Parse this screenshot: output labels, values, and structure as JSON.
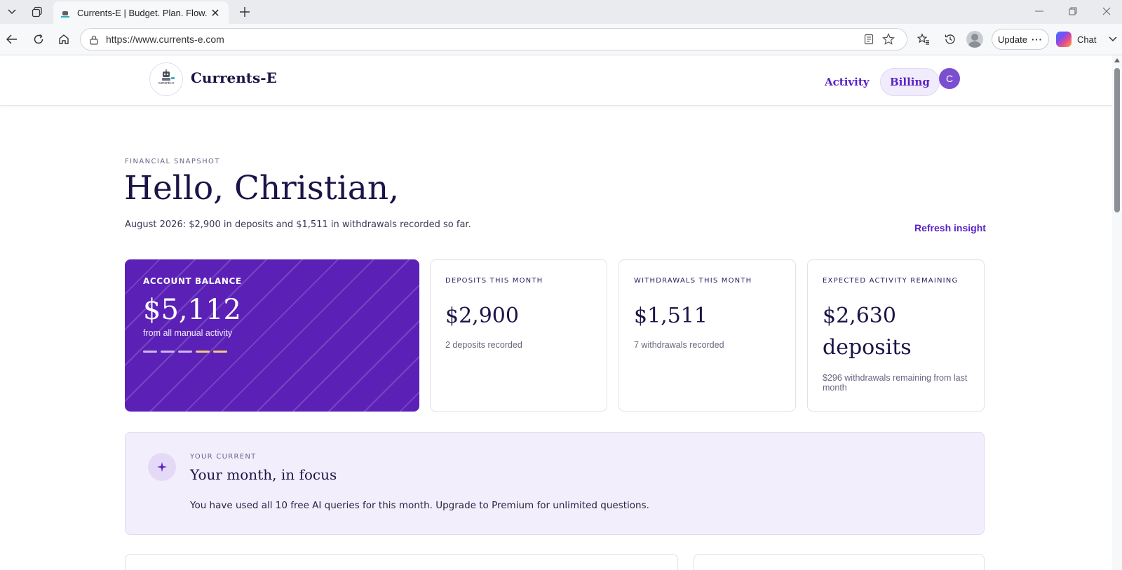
{
  "browser": {
    "tab_title": "Currents-E | Budget. Plan. Flow.",
    "url": "https://www.currents-e.com",
    "update_label": "Update",
    "chat_label": "Chat"
  },
  "site": {
    "brand": "Currents-E",
    "logo_text": "currents-e",
    "nav": {
      "activity": "Activity",
      "billing": "Billing"
    },
    "avatar_initial": "C"
  },
  "hero": {
    "eyebrow": "FINANCIAL SNAPSHOT",
    "greeting": "Hello, Christian,",
    "summary": "August 2026: $2,900 in deposits and $1,511 in withdrawals recorded so far.",
    "refresh_label": "Refresh insight"
  },
  "cards": {
    "balance": {
      "label": "ACCOUNT BALANCE",
      "value": "$5,112",
      "note": "from all manual activity"
    },
    "deposits": {
      "label": "DEPOSITS THIS MONTH",
      "value": "$2,900",
      "note": "2 deposits recorded"
    },
    "withdrawals": {
      "label": "WITHDRAWALS THIS MONTH",
      "value": "$1,511",
      "note": "7 withdrawals recorded"
    },
    "expected": {
      "label": "EXPECTED ACTIVITY REMAINING",
      "value_line1": "$2,630",
      "value_line2": "deposits",
      "note": "$296 withdrawals remaining from last month"
    }
  },
  "insight": {
    "eyebrow": "YOUR CURRENT",
    "title": "Your month, in focus",
    "text": "You have used all 10 free AI queries for this month. Upgrade to Premium for unlimited questions."
  },
  "colors": {
    "brand_purple": "#5b21b6",
    "link_purple": "#5a22c7",
    "dash_light": "#c9b8f0",
    "dash_accent": "#f2c97d"
  }
}
